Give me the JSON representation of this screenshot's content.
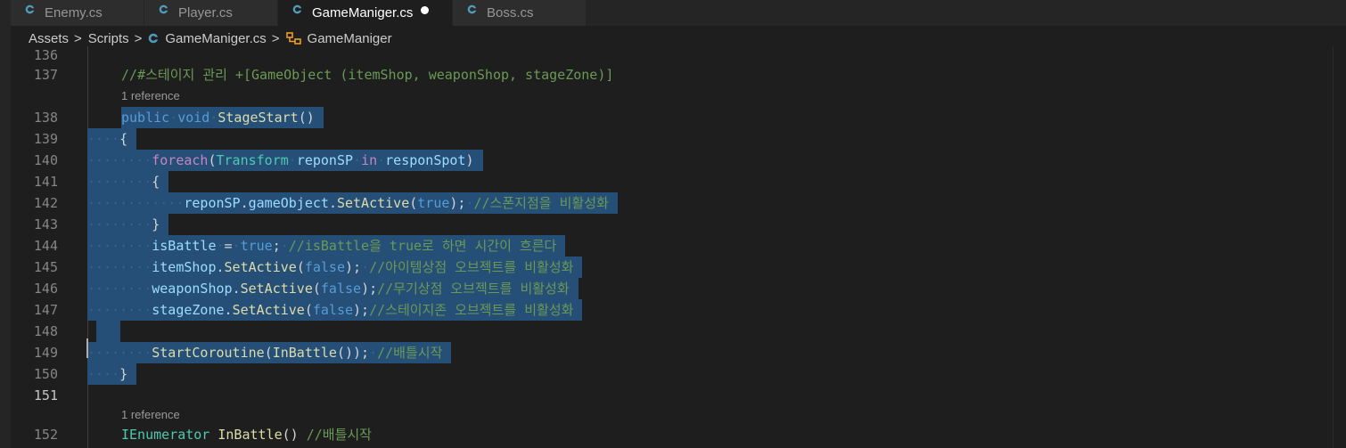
{
  "tabs": [
    {
      "label": "Enemy.cs",
      "active": false,
      "modified": false,
      "icon": "csharp-icon"
    },
    {
      "label": "Player.cs",
      "active": false,
      "modified": false,
      "icon": "csharp-icon"
    },
    {
      "label": "GameManiger.cs",
      "active": true,
      "modified": true,
      "icon": "csharp-icon"
    },
    {
      "label": "Boss.cs",
      "active": false,
      "modified": false,
      "icon": "csharp-icon"
    }
  ],
  "breadcrumbs": {
    "items": [
      "Assets",
      "Scripts",
      "GameManiger.cs",
      "GameManiger"
    ],
    "separator": ">"
  },
  "colors": {
    "editor_bg": "#1e1e1e",
    "tab_bar_bg": "#252526",
    "inactive_tab_bg": "#2d2d2d",
    "selection": "#264f78",
    "keyword": "#569cd6",
    "control_keyword": "#c586c0",
    "type": "#4ec9b0",
    "function": "#dcdcaa",
    "variable": "#9cdcfe",
    "comment": "#6a9955",
    "csharp_icon": "#519aba",
    "class_icon": "#ee9d28"
  },
  "codelens": {
    "line138": "1 reference",
    "line152": "1 reference"
  },
  "code": {
    "l136": {
      "num": "136"
    },
    "l137": {
      "num": "137",
      "comment": "//#스테이지 관리 +[GameObject (itemShop, weaponShop, stageZone)]"
    },
    "l138": {
      "num": "138",
      "kw1": "public",
      "kw2": "void",
      "fn": "StageStart",
      "paren": "()"
    },
    "l139": {
      "num": "139",
      "brace": "{"
    },
    "l140": {
      "num": "140",
      "ctrl": "foreach",
      "p1": "(",
      "type": "Transform",
      "var1": "reponSP",
      "in": "in",
      "var2": "responSpot",
      "p2": ")"
    },
    "l141": {
      "num": "141",
      "brace": "{"
    },
    "l142": {
      "num": "142",
      "var": "reponSP",
      "dot1": ".",
      "var2": "gameObject",
      "dot2": ".",
      "fn": "SetActive",
      "p1": "(",
      "kw": "true",
      "p2": ");",
      "comment": "//스폰지점을 비활성화"
    },
    "l143": {
      "num": "143",
      "brace": "}"
    },
    "l144": {
      "num": "144",
      "var": "isBattle",
      "op": "=",
      "kw": "true",
      "semi": ";",
      "comment": "//isBattle을 true로 하면 시간이 흐른다"
    },
    "l145": {
      "num": "145",
      "var": "itemShop",
      "dot": ".",
      "fn": "SetActive",
      "p1": "(",
      "kw": "false",
      "p2": ");",
      "comment": "//아이템상점 오브젝트를 비활성화"
    },
    "l146": {
      "num": "146",
      "var": "weaponShop",
      "dot": ".",
      "fn": "SetActive",
      "p1": "(",
      "kw": "false",
      "p2": ");",
      "comment": "//무기상점 오브젝트를 비활성화"
    },
    "l147": {
      "num": "147",
      "var": "stageZone",
      "dot": ".",
      "fn": "SetActive",
      "p1": "(",
      "kw": "false",
      "p2": ");",
      "comment": "//스테이지존 오브젝트를 비활성화"
    },
    "l148": {
      "num": "148"
    },
    "l149": {
      "num": "149",
      "fn1": "StartCoroutine",
      "p1": "(",
      "fn2": "InBattle",
      "p2": "());",
      "comment": "//배틀시작"
    },
    "l150": {
      "num": "150",
      "brace": "}"
    },
    "l151": {
      "num": "151"
    },
    "l152": {
      "num": "152",
      "type": "IEnumerator",
      "fn": "InBattle",
      "paren": "()",
      "comment": "//배틀시작"
    }
  }
}
